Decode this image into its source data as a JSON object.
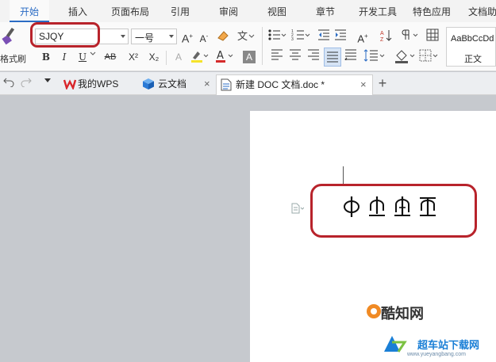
{
  "menu": {
    "tabs": [
      "开始",
      "插入",
      "页面布局",
      "引用",
      "审阅",
      "视图",
      "章节",
      "开发工具",
      "特色应用",
      "文档助"
    ]
  },
  "ribbon": {
    "font_name": "SJQY",
    "font_size": "一号",
    "format_painter_label": "格式刷",
    "bold": "B",
    "italic": "I",
    "underline": "U",
    "strike": "AB",
    "superscript": "X²",
    "subscript": "X₂",
    "grow_font": "A",
    "shrink_font": "A",
    "font_color_letter": "A",
    "text_effect_letter": "A",
    "style_preview": "AaBbCcDd",
    "style_name": "正文",
    "accent_color": "#2b6cc4",
    "highlight_color": "#b8232b"
  },
  "tabbar": {
    "tabs": [
      {
        "label": "我的WPS",
        "icon": "wps-logo-icon"
      },
      {
        "label": "云文档",
        "icon": "cloud-cube-icon"
      },
      {
        "label": "新建 DOC 文档.doc *",
        "icon": "doc-file-icon"
      }
    ],
    "new_tab": "+"
  },
  "document": {
    "glyphs": [
      "中-variant-1",
      "中-variant-2",
      "中-variant-3",
      "中-variant-4"
    ]
  },
  "watermark": {
    "brand": "酷知网",
    "brand2": "超车站下载网",
    "url": "www.yueyangbang.com"
  }
}
